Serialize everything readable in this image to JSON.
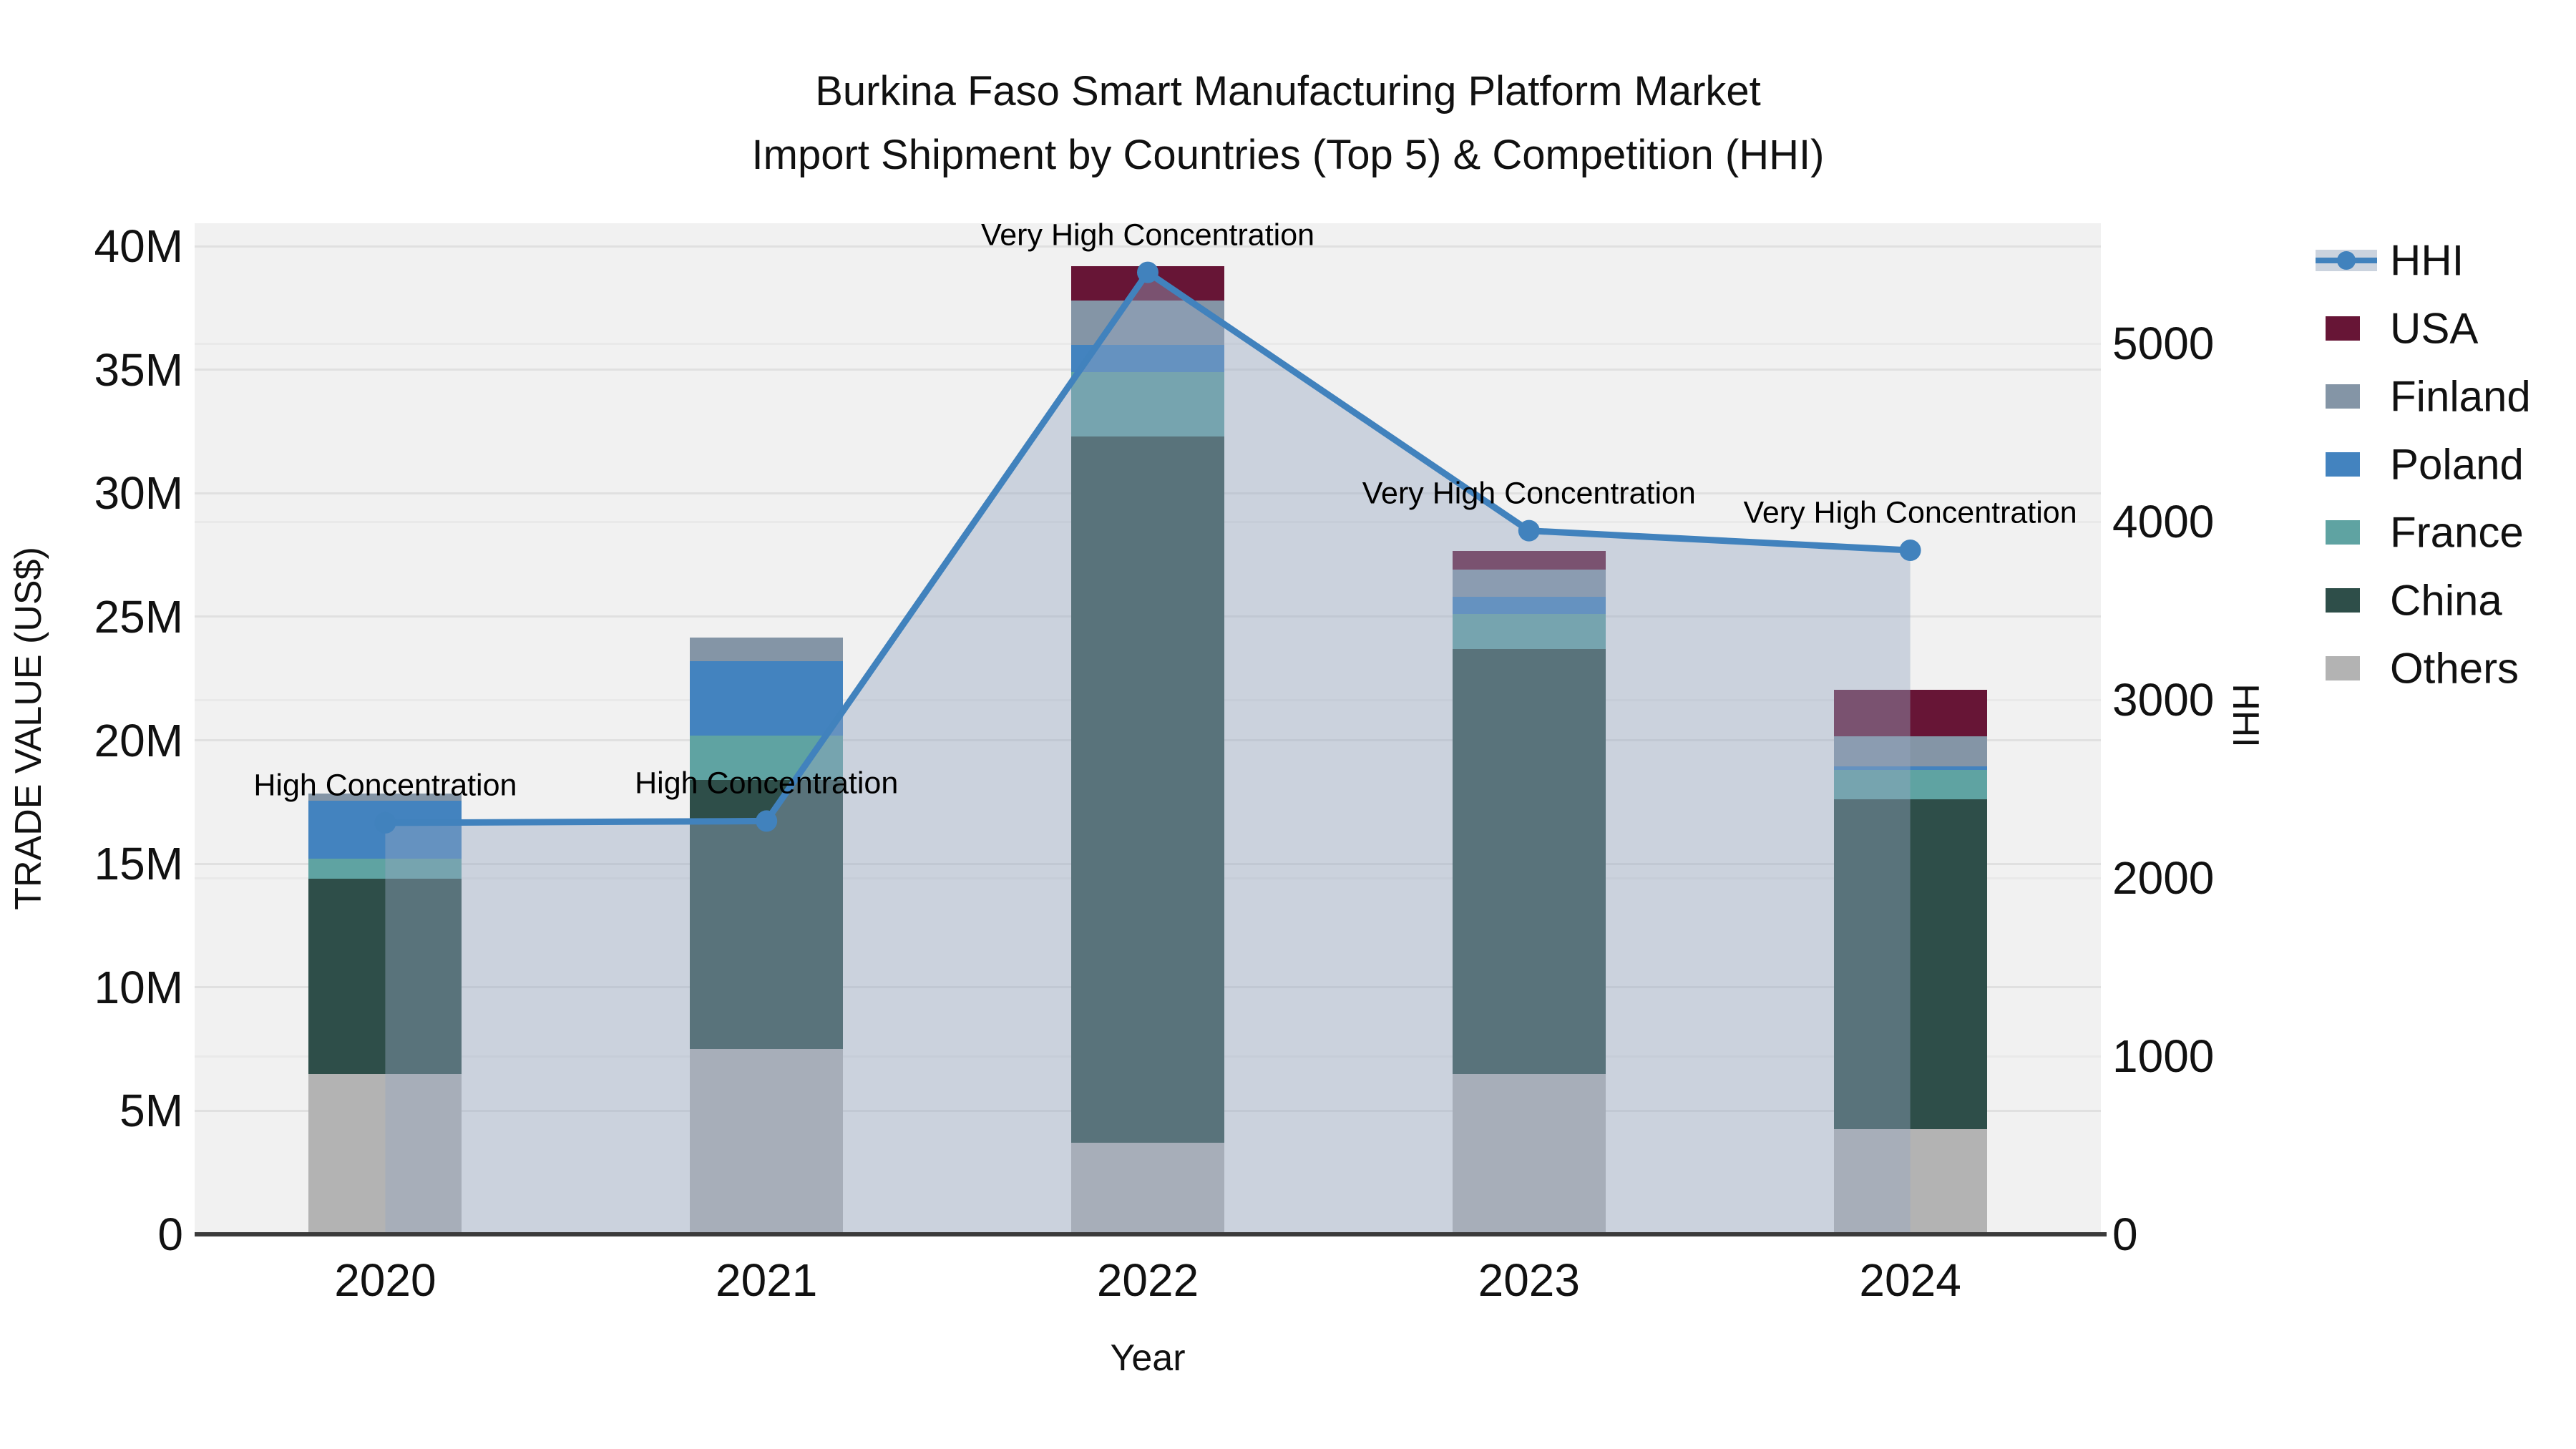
{
  "title": {
    "line1": "Burkina Faso Smart Manufacturing Platform Market",
    "line2": "Import Shipment by Countries (Top 5) & Competition (HHI)"
  },
  "chart_data": {
    "type": "combo-stacked-bar-line",
    "categories": [
      "2020",
      "2021",
      "2022",
      "2023",
      "2024"
    ],
    "bar_unit": "M US$",
    "bar_series": [
      {
        "name": "Others",
        "color": "#b3b3b3",
        "values": [
          6.5,
          7.5,
          3.7,
          6.5,
          4.25
        ]
      },
      {
        "name": "China",
        "color": "#2e4e49",
        "values": [
          7.9,
          10.9,
          28.6,
          17.2,
          13.35
        ]
      },
      {
        "name": "France",
        "color": "#5fa3a2",
        "values": [
          0.8,
          1.8,
          2.6,
          1.4,
          1.2
        ]
      },
      {
        "name": "Poland",
        "color": "#4383bf",
        "values": [
          2.35,
          3.0,
          1.1,
          0.7,
          0.15
        ]
      },
      {
        "name": "Finland",
        "color": "#8495a6",
        "values": [
          0.3,
          0.95,
          1.8,
          1.1,
          1.2
        ]
      },
      {
        "name": "USA",
        "color": "#671536",
        "values": [
          0,
          0,
          1.4,
          0.75,
          1.9
        ]
      }
    ],
    "line_series": {
      "name": "HHI",
      "color": "#4182bd",
      "area_fill": "rgba(150,168,193,0.42)",
      "axis": "right",
      "values": [
        2310,
        2320,
        5400,
        3950,
        3840
      ]
    },
    "annotations": [
      "High Concentration",
      "High Concentration",
      "Very High Concentration",
      "Very High Concentration",
      "Very High Concentration"
    ],
    "y_left": {
      "title": "TRADE VALUE (US$)",
      "ticks": [
        "0",
        "5M",
        "10M",
        "15M",
        "20M",
        "25M",
        "30M",
        "35M",
        "40M"
      ],
      "tick_values": [
        0,
        5,
        10,
        15,
        20,
        25,
        30,
        35,
        40
      ]
    },
    "y_right": {
      "title": "HHI",
      "ticks": [
        "0",
        "1000",
        "2000",
        "3000",
        "4000",
        "5000"
      ],
      "tick_values": [
        0,
        1000,
        2000,
        3000,
        4000,
        5000
      ]
    },
    "x": {
      "title": "Year"
    },
    "legend": {
      "items": [
        {
          "label": "HHI",
          "type": "line"
        },
        {
          "label": "USA",
          "type": "swatch"
        },
        {
          "label": "Finland",
          "type": "swatch"
        },
        {
          "label": "Poland",
          "type": "swatch"
        },
        {
          "label": "France",
          "type": "swatch"
        },
        {
          "label": "China",
          "type": "swatch"
        },
        {
          "label": "Others",
          "type": "swatch"
        }
      ]
    }
  }
}
